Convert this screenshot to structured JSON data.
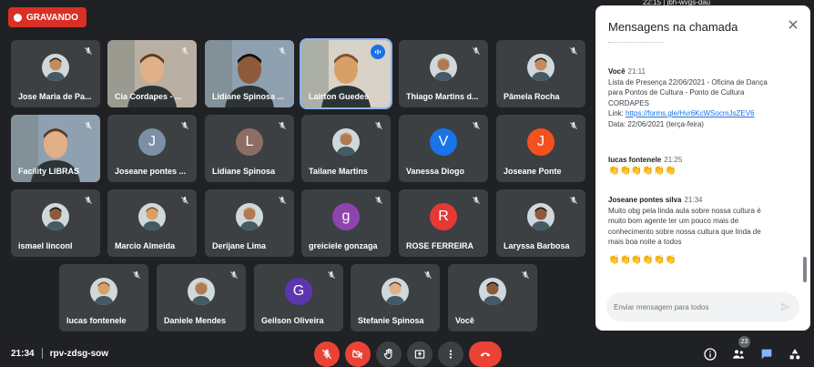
{
  "recording": {
    "label": "GRAVANDO"
  },
  "top_strip": {
    "text": "22:15 | jbh-wvgs-dau"
  },
  "participants": [
    {
      "name": "Jose Maria de Pa...",
      "kind": "photo",
      "muted": true
    },
    {
      "name": "Cia Cordapes - ...",
      "kind": "video",
      "muted": true
    },
    {
      "name": "Lidiane Spinosa ...",
      "kind": "video",
      "muted": true
    },
    {
      "name": "Lairton Guedes",
      "kind": "video",
      "muted": false,
      "speaking": true
    },
    {
      "name": "Thiago Martins d...",
      "kind": "photo",
      "muted": true
    },
    {
      "name": "Pâmela Rocha",
      "kind": "photo",
      "muted": true
    },
    {
      "name": "Facility LIBRAS",
      "kind": "video",
      "muted": true
    },
    {
      "name": "Joseane pontes ...",
      "kind": "letter",
      "letter": "J",
      "color": "#7b8fa6",
      "muted": true
    },
    {
      "name": "Lidiane Spinosa",
      "kind": "letter",
      "letter": "L",
      "color": "#8d6e63",
      "muted": true
    },
    {
      "name": "Tailane Martins",
      "kind": "photo",
      "muted": true
    },
    {
      "name": "Vanessa Diogo",
      "kind": "letter",
      "letter": "V",
      "color": "#1a73e8",
      "muted": true
    },
    {
      "name": "Joseane Ponte",
      "kind": "letter",
      "letter": "J",
      "color": "#f4511e",
      "muted": true
    },
    {
      "name": "ismael linconl",
      "kind": "photo",
      "muted": true
    },
    {
      "name": "Marcio Almeida",
      "kind": "photo",
      "muted": true
    },
    {
      "name": "Derijane Lima",
      "kind": "photo",
      "muted": true
    },
    {
      "name": "greiciele gonzaga",
      "kind": "letter",
      "letter": "g",
      "color": "#8e44ad",
      "muted": true
    },
    {
      "name": "ROSE FERREIRA",
      "kind": "letter",
      "letter": "R",
      "color": "#e53935",
      "muted": true
    },
    {
      "name": "Laryssa Barbosa",
      "kind": "photo",
      "muted": true
    },
    {
      "name": "lucas fontenele",
      "kind": "photo",
      "muted": true
    },
    {
      "name": "Daniele Mendes",
      "kind": "photo",
      "muted": true
    },
    {
      "name": "Geilson Oliveira",
      "kind": "letter",
      "letter": "G",
      "color": "#5e35b1",
      "muted": true
    },
    {
      "name": "Stefanie Spinosa",
      "kind": "photo",
      "muted": true
    },
    {
      "name": "Você",
      "kind": "photo",
      "muted": true
    }
  ],
  "bottom": {
    "time": "21:34",
    "meeting_code": "rpv-zdsg-sow",
    "participant_count": "23"
  },
  "chat": {
    "title": "Mensagens na chamada",
    "messages": [
      {
        "sender": "Você",
        "time": "21:11",
        "lines": [
          "Lista de Presença 22/06/2021 - Oficina de Dança",
          "para Pontos de Cultura -  Ponto de Cultura",
          "CORDAPES"
        ],
        "link_prefix": "Link: ",
        "link": "https://forms.gle/Hvr6KcWSocmJsZEV6",
        "after": "Data: 22/06/2021 (terça-feira)"
      },
      {
        "sender": "lucas fontenele",
        "time": "21:25",
        "emoji": "👏👏👏👏👏👏"
      },
      {
        "sender": "Joseane pontes silva",
        "time": "21:34",
        "lines": [
          "Muito obg pela linda aula sobre nossa cultura é",
          "muito bom agente ter um pouco mais de",
          "conhecimento sobre nossa cultura  que linda de",
          "mais  boa noite a todos"
        ],
        "emoji": "👏👏👏👏👏👏"
      }
    ],
    "input_placeholder": "Enviar mensagem para todos"
  },
  "colors": {
    "bg": "#202124",
    "tile": "#3c4043",
    "end_call": "#ea4335",
    "accent": "#1a73e8"
  },
  "icons": [
    "mic-off-icon",
    "camera-off-icon",
    "raise-hand-icon",
    "present-icon",
    "more-options-icon",
    "end-call-icon",
    "info-icon",
    "people-icon",
    "chat-icon",
    "activities-icon",
    "close-icon",
    "send-icon",
    "speaking-icon"
  ]
}
